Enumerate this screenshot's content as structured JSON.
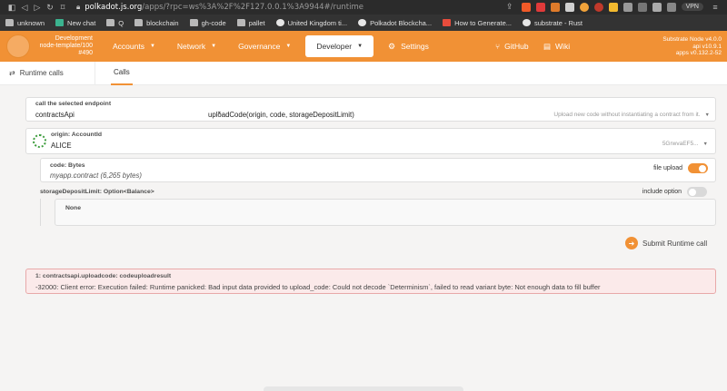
{
  "browser": {
    "url_host": "polkadot.js.org",
    "url_path": "/apps/?rpc=ws%3A%2F%2F127.0.0.1%3A9944#/runtime",
    "vpn_label": "VPN",
    "shield_count": "13",
    "bookmarks": [
      {
        "label": "unknown"
      },
      {
        "label": "New chat"
      },
      {
        "label": "Q"
      },
      {
        "label": "blockchain"
      },
      {
        "label": "gh-code"
      },
      {
        "label": "pallet"
      },
      {
        "label": "United Kingdom ti..."
      },
      {
        "label": "Polkadot Blockcha..."
      },
      {
        "label": "How to Generate..."
      },
      {
        "label": "substrate - Rust"
      }
    ]
  },
  "header": {
    "node": {
      "line1": "Development",
      "line2": "node-template/100",
      "line3": "#490"
    },
    "menu": [
      {
        "label": "Accounts"
      },
      {
        "label": "Network"
      },
      {
        "label": "Governance"
      },
      {
        "label": "Developer"
      },
      {
        "label": "Settings"
      }
    ],
    "github_label": "GitHub",
    "wiki_label": "Wiki",
    "version": {
      "line1": "Substrate Node v4.0.0",
      "line2": "api v10.9.1",
      "line3": "apps v0.132.2-52"
    }
  },
  "subnav": {
    "title": "Runtime calls",
    "tab": "Calls"
  },
  "endpoint": {
    "label": "call the selected endpoint",
    "api": "contractsApi",
    "method": "uploadCode(origin, code, storageDepositLimit)",
    "description": "Upload new code without instantiating a contract from it."
  },
  "origin": {
    "label": "origin: AccountId",
    "name": "ALICE",
    "address": "5GrwvaEF5..."
  },
  "code": {
    "label": "code: Bytes",
    "value": "myapp.contract (6,265 bytes)",
    "toggle_label": "file upload",
    "toggle_on": true
  },
  "storage": {
    "label": "storageDepositLimit: Option<Balance>",
    "toggle_label": "include option",
    "toggle_on": false,
    "value": "None"
  },
  "submit_label": "Submit Runtime call",
  "error": {
    "title": "1: contractsapi.uploadcode: codeuploadresult",
    "message": "-32000: Client error: Execution failed: Runtime panicked: Bad input data provided to upload_code: Could not decode `Determinism`, failed to read variant byte: Not enough data to fill buffer"
  },
  "colors": {
    "accent": "#f19135",
    "toggle_off": "#d9d9d9"
  }
}
